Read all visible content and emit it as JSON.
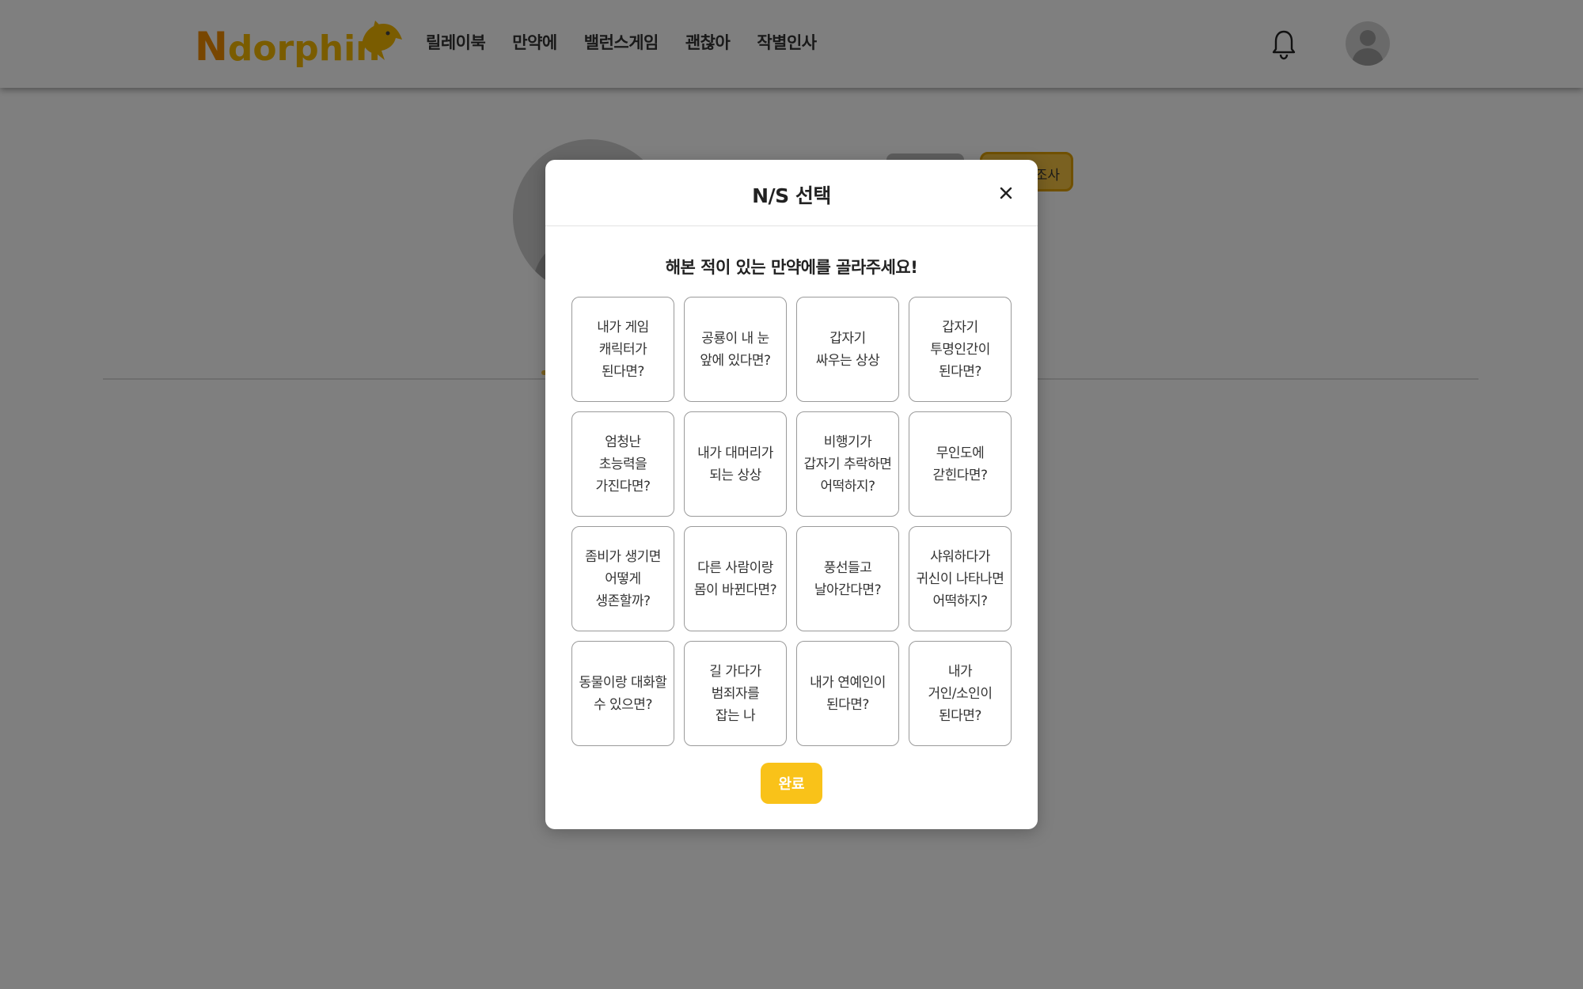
{
  "header": {
    "logo_text_cap": "N",
    "logo_text_rest": "dorphin",
    "nav": [
      "릴레이북",
      "만약에",
      "밸런스게임",
      "괜찮아",
      "작별인사"
    ]
  },
  "profile": {
    "survey_badge": "조사"
  },
  "modal": {
    "title": "N/S 선택",
    "question": "해본 적이 있는 만약에를 골라주세요!",
    "options": [
      "내가 게임\n캐릭터가\n된다면?",
      "공룡이 내 눈\n앞에 있다면?",
      "갑자기\n싸우는 상상",
      "갑자기\n투명인간이\n된다면?",
      "엄청난\n초능력을\n가진다면?",
      "내가 대머리가\n되는 상상",
      "비행기가\n갑자기 추락하면\n어떡하지?",
      "무인도에\n갇힌다면?",
      "좀비가 생기면\n어떻게\n생존할까?",
      "다른 사람이랑\n몸이 바뀐다면?",
      "풍선들고\n날아간다면?",
      "샤워하다가\n귀신이 나타나면\n어떡하지?",
      "동물이랑 대화할\n수 있으면?",
      "길 가다가\n범죄자를\n잡는 나",
      "내가 연예인이\n된다면?",
      "내가\n거인/소인이\n된다면?"
    ],
    "done_label": "완료"
  },
  "colors": {
    "accent": "#f9c219",
    "overlay": "rgba(0,0,0,0.5)"
  },
  "icons": {
    "close": "close-icon",
    "bell": "bell-icon",
    "avatar": "user-avatar-icon",
    "logo_mascot": "dolphin-icon"
  }
}
